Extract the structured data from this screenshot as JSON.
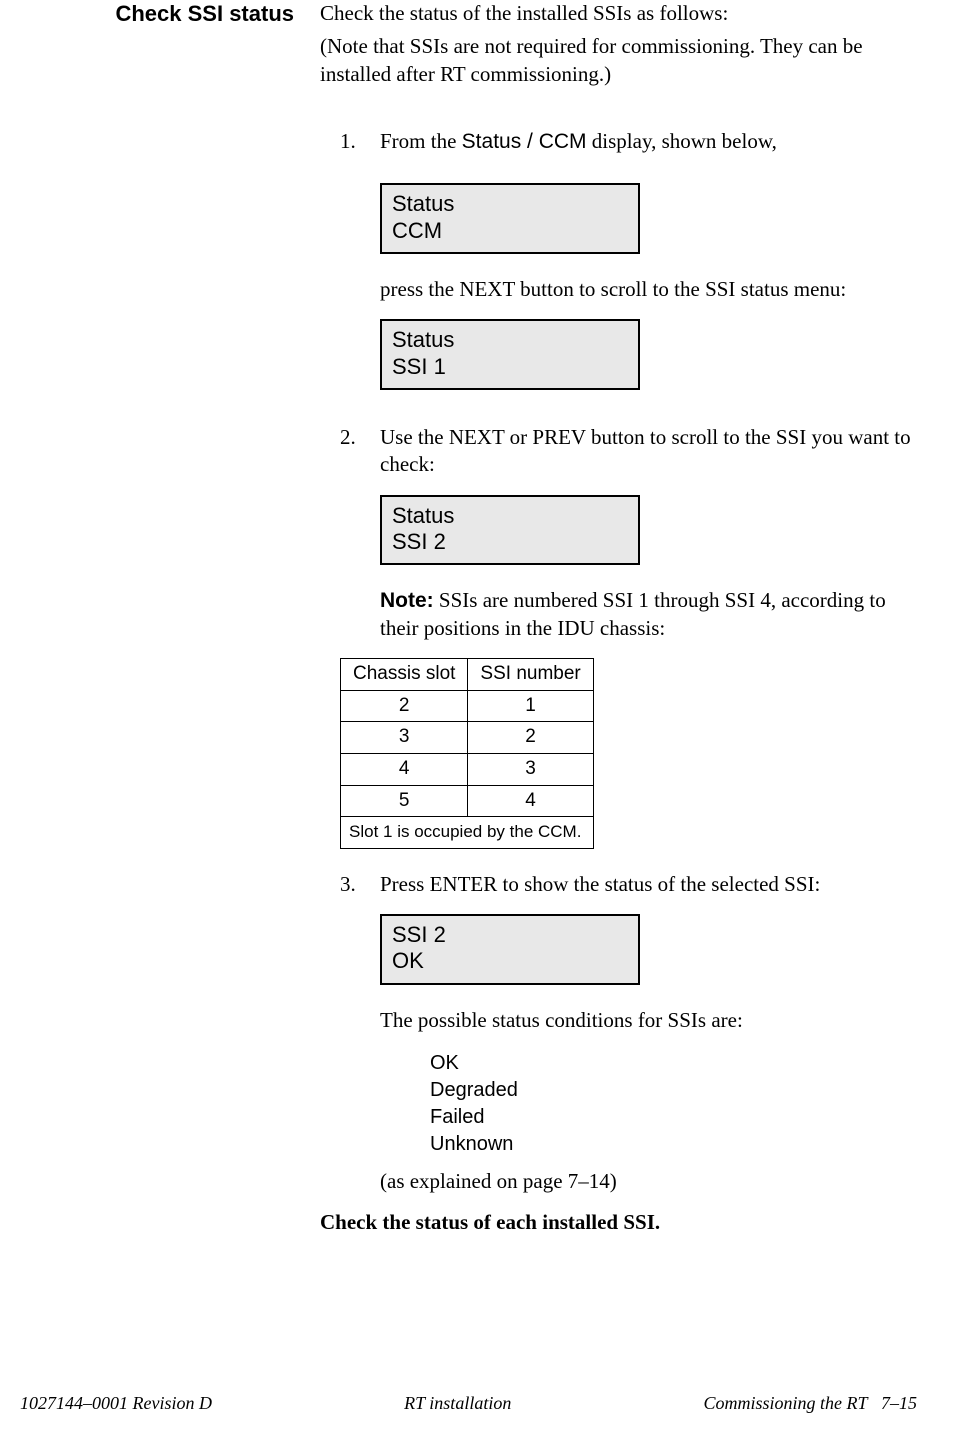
{
  "side_heading": "Check SSI status",
  "intro": {
    "sentence": "Check the status of the installed SSIs as follows:",
    "parenthetical": "(Note that SSIs are not required for commissioning. They can be installed after RT commissioning.)"
  },
  "steps": {
    "s1": {
      "num": "1.",
      "pre_text": "From the ",
      "ui_name": "Status / CCM",
      "post_text": " display, shown below,",
      "lcd_line1": "Status",
      "lcd_line2": "CCM",
      "after_text": "press the NEXT button to scroll to the SSI status menu:",
      "lcd2_line1": "Status",
      "lcd2_line2": "SSI 1"
    },
    "s2": {
      "num": "2.",
      "text": "Use the NEXT or PREV button to scroll to the SSI you want to check:",
      "lcd_line1": "Status",
      "lcd_line2": "SSI 2",
      "note_label": "Note:",
      "note_text": " SSIs are numbered SSI 1 through SSI 4, according to their positions in the IDU chassis:"
    },
    "s3": {
      "num": "3.",
      "text": "Press ENTER to show the status of the selected SSI:",
      "lcd_line1": "SSI 2",
      "lcd_line2": "OK",
      "after_text": "The possible status conditions for SSIs are:",
      "statuses": {
        "a": "OK",
        "b": "Degraded",
        "c": "Failed",
        "d": "Unknown"
      },
      "explain": "(as explained on page 7–14)"
    }
  },
  "table": {
    "head_a": "Chassis slot",
    "head_b": "SSI number",
    "rows": {
      "r1a": "2",
      "r1b": "1",
      "r2a": "3",
      "r2b": "2",
      "r3a": "4",
      "r3b": "3",
      "r4a": "5",
      "r4b": "4"
    },
    "footnote": "Slot 1 is occupied by the CCM."
  },
  "final_instruction": "Check the status of each installed SSI.",
  "footer": {
    "left": "1027144–0001  Revision D",
    "center": "RT installation",
    "right_title": "Commissioning the RT",
    "right_page": "7–15"
  }
}
